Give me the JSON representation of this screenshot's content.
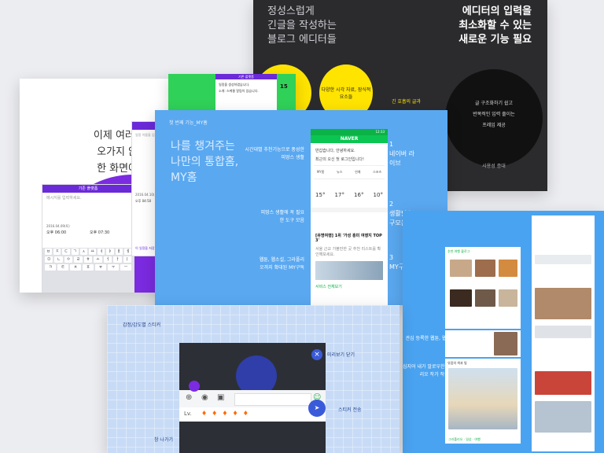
{
  "dark_card": {
    "left_lines": [
      "정성스럽게",
      "긴글을 작성하는",
      "블로그 에디터들"
    ],
    "right_lines": [
      "에디터의 입력을",
      "최소화할 수 있는",
      "새로운 기능 필요"
    ],
    "circle_1": "",
    "circle_2": "다양한 시각 자료, 장식적 요소들",
    "circle_3_caption": "긴 호흡의 글과",
    "black_circle_lines": [
      "글 구조화하기 쉽고",
      "반복적인 입력 줄이는",
      "프레임 제공"
    ],
    "black_circle_footer": "사용성 증대",
    "colors": {
      "yellow": "#ffe400",
      "bg": "#2b2b2e"
    }
  },
  "white_card": {
    "headline": [
      "이제 여러 창",
      "오가지 않고",
      "한 화면에서"
    ],
    "phone": {
      "top_label": "기존 플랫폼",
      "input_placeholder": "메시지를 입력하세요.",
      "time_1": "2016.04.09(토)",
      "time_2": "오후 06:00",
      "time_3": "오후 07:30",
      "keys_row1": [
        "ㅂ",
        "ㅈ",
        "ㄷ",
        "ㄱ",
        "ㅅ",
        "ㅛ",
        "ㅕ",
        "ㅑ",
        "ㅐ",
        "ㅔ"
      ],
      "keys_row2": [
        "ㅁ",
        "ㄴ",
        "ㅇ",
        "ㄹ",
        "ㅎ",
        "ㅗ",
        "ㅓ",
        "ㅏ",
        "ㅣ"
      ],
      "keys_row3": [
        "ㅋ",
        "ㅌ",
        "ㅊ",
        "ㅍ",
        "ㅠ",
        "ㅜ",
        "ㅡ"
      ]
    },
    "second_phone": {
      "placeholder": "일정 이름을 입력하세요",
      "time_a": "2016.04.10(토)",
      "time_b": "오후 04:50",
      "footer_btn": "이 일정을 저장"
    }
  },
  "green_card": {
    "title": "기존 플랫폼",
    "badge": "15",
    "lines": [
      "일정을 생성하였습니다.",
      "소개: 스케줄 알림이 있습니다."
    ]
  },
  "blue_card": {
    "header": "첫 번째 기능_MY홈",
    "headline": [
      "나를 챙겨주는",
      "나만의 통합홈,",
      "MY홈"
    ],
    "descs": [
      {
        "text": "시간대별 추천기능으로 풍성한 피땅스 생활"
      },
      {
        "text": "피땅스 생활에 꼭 필요한 도구 모음"
      },
      {
        "text": "웹툰, 웹소설, 그라폴리오까지 확대된 MY구독"
      }
    ],
    "nums": [
      {
        "n": "1",
        "label": "네이버 라이브"
      },
      {
        "n": "2",
        "label": "생활필수 도구모음"
      },
      {
        "n": "3",
        "label": "MY구독"
      }
    ],
    "phone": {
      "status": "12:33",
      "logo": "NAVER",
      "greeting": "반갑습니다, 안녕하세요.",
      "greeting2": "최근의 오신 첫 로그인입니다!",
      "tabs": [
        "MY홈",
        "뉴스",
        "연예",
        "스포츠"
      ],
      "weather": "15°",
      "weather2": "17°",
      "weather3": "16°",
      "weather4": "10°",
      "news_title": "[유명여행] 1위 '가성 흥미 여행지 TOP 3'",
      "news_body": "서울 근교 가볼만한 곳 추천 리스트를 확인해보세요.",
      "footer": "서비스 전체보기"
    }
  },
  "right_card": {
    "caption1": "관심 등록한 웹툰, 웹소설은 물론",
    "caption2": "심지어 내가 말로우한 그라폴리오 작가 작품까지!",
    "tile_title": "추천 여행 블로그",
    "tile_title2": "유럽의 색과 빛",
    "tile_footer": "그라폴리오 · 일상 · 여행"
  },
  "bottom_card": {
    "side_label": "감정/감도별 스티커",
    "label_close": "미리보기 닫기",
    "label_send": "스티커 전송",
    "label_exit": "창 나가기",
    "level": "Lv."
  }
}
